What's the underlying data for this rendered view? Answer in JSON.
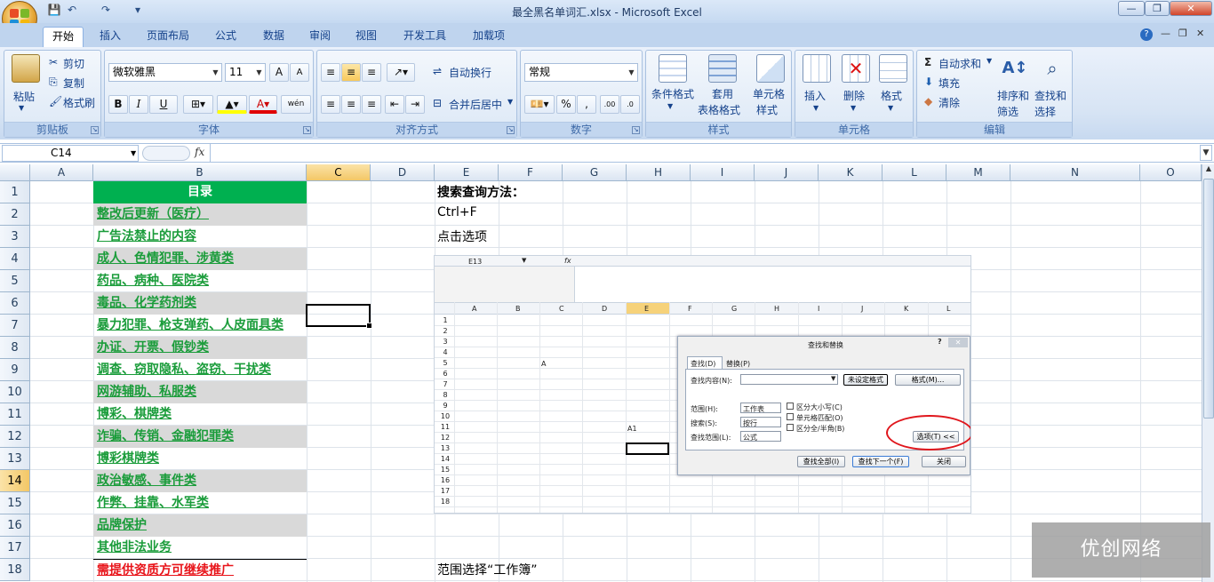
{
  "window": {
    "title": "最全黑名单词汇.xlsx - Microsoft Excel",
    "minimize": "—",
    "restore": "❐",
    "close": "✕"
  },
  "quick_access": {
    "save": "💾",
    "undo": "↶",
    "redo": "↷",
    "customize": "▾"
  },
  "tabs": [
    "开始",
    "插入",
    "页面布局",
    "公式",
    "数据",
    "审阅",
    "视图",
    "开发工具",
    "加载项"
  ],
  "ribbon": {
    "clipboard": {
      "label": "剪贴板",
      "paste": "粘贴",
      "cut": "剪切",
      "copy": "复制",
      "format_painter": "格式刷"
    },
    "font": {
      "label": "字体",
      "font_name": "微软雅黑",
      "font_size": "11",
      "bold": "B",
      "italic": "I",
      "underline": "U",
      "grow": "A",
      "shrink": "A",
      "phonetic": "wén"
    },
    "alignment": {
      "label": "对齐方式",
      "wrap": "自动换行",
      "merge": "合并后居中"
    },
    "number": {
      "label": "数字",
      "format": "常规",
      "percent": "%",
      "comma": ","
    },
    "styles": {
      "label": "样式",
      "conditional": "条件格式",
      "table": "套用",
      "table2": "表格格式",
      "cell_style": "单元格",
      "cell_style2": "样式"
    },
    "cells": {
      "label": "单元格",
      "insert": "插入",
      "delete": "删除",
      "format": "格式"
    },
    "editing": {
      "label": "编辑",
      "autosum": "自动求和",
      "fill": "填充",
      "clear": "清除",
      "sort": "排序和",
      "sort2": "筛选",
      "find": "查找和",
      "find2": "选择"
    }
  },
  "formula_bar": {
    "name_box": "C14",
    "fx": "fx",
    "content": ""
  },
  "columns": [
    "A",
    "B",
    "C",
    "D",
    "E",
    "F",
    "G",
    "H",
    "I",
    "J",
    "K",
    "L",
    "M",
    "N",
    "O"
  ],
  "rows": [
    "1",
    "2",
    "3",
    "4",
    "5",
    "6",
    "7",
    "8",
    "9",
    "10",
    "11",
    "12",
    "13",
    "14",
    "15",
    "16",
    "17",
    "18"
  ],
  "selected": {
    "column": "C",
    "row": "14"
  },
  "catalog": {
    "header": "目录",
    "items": [
      "整改后更新（医疗）",
      "广告法禁止的内容",
      "成人、色情犯罪、涉黄类",
      "药品、病种、医院类",
      "毒品、化学药剂类",
      "暴力犯罪、枪支弹药、人皮面具类",
      "办证、开票、假钞类",
      "调查、窃取隐私、盗窃、干扰类",
      "网游辅助、私服类",
      "博彩、棋牌类",
      "诈骗、传销、金融犯罪类",
      "博彩棋牌类",
      "政治敏感、事件类",
      "作弊、挂靠、水军类",
      "品牌保护",
      "其他非法业务",
      "需提供资质方可继续推广"
    ]
  },
  "notes": {
    "title": "搜索查询方法：",
    "shortcut": "Ctrl+F",
    "step": "点击选项",
    "scope": "范围选择“工作簿”"
  },
  "screenshot": {
    "namebox": "E13",
    "fx": "fx",
    "columns": [
      "A",
      "B",
      "C",
      "D",
      "E",
      "F",
      "G",
      "H",
      "I",
      "J",
      "K",
      "L"
    ],
    "rows": [
      "1",
      "2",
      "3",
      "4",
      "5",
      "6",
      "7",
      "8",
      "9",
      "10",
      "11",
      "12",
      "13",
      "14",
      "15",
      "16",
      "17",
      "18"
    ],
    "cell_a": "A",
    "cell_a1": "A1",
    "dialog": {
      "title": "查找和替换",
      "help": "?",
      "close": "✕",
      "tab_find": "查找(D)",
      "tab_replace": "替换(P)",
      "find_what": "查找内容(N):",
      "no_format": "未设定格式",
      "format_btn": "格式(M)...",
      "within": "范围(H):",
      "within_value": "工作表",
      "search": "搜索(S):",
      "search_value": "按行",
      "look_in": "查找范围(L):",
      "look_in_value": "公式",
      "match_case": "区分大小写(C)",
      "match_cell": "单元格匹配(O)",
      "match_width": "区分全/半角(B)",
      "options": "选项(T) <<",
      "find_all": "查找全部(I)",
      "find_next": "查找下一个(F)",
      "close_btn": "关闭"
    }
  },
  "watermark": "优创网络",
  "colors": {
    "green": "#00b050",
    "link_green": "#1a9c3a",
    "red": "#e8141a",
    "gray": "#d9d9d9"
  }
}
